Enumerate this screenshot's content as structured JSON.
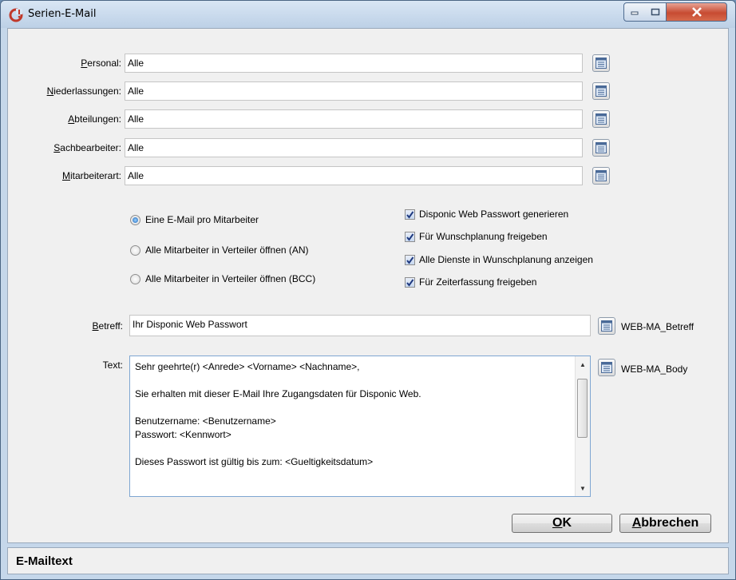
{
  "window": {
    "title": "Serien-E-Mail"
  },
  "filters": [
    {
      "label": "Personal:",
      "mnemonic": "P",
      "rest": "ersonal:",
      "value": "Alle"
    },
    {
      "label": "Niederlassungen:",
      "mnemonic": "N",
      "rest": "iederlassungen:",
      "value": "Alle"
    },
    {
      "label": "Abteilungen:",
      "mnemonic": "A",
      "rest": "bteilungen:",
      "value": "Alle"
    },
    {
      "label": "Sachbearbeiter:",
      "mnemonic": "S",
      "rest": "achbearbeiter:",
      "value": "Alle"
    },
    {
      "label": "Mitarbeiterart:",
      "mnemonic": "M",
      "rest": "itarbeiterart:",
      "value": "Alle"
    }
  ],
  "radios": [
    {
      "label": "Eine E-Mail pro Mitarbeiter",
      "selected": true
    },
    {
      "label": "Alle Mitarbeiter in Verteiler öffnen (AN)",
      "selected": false
    },
    {
      "label": "Alle Mitarbeiter in Verteiler öffnen (BCC)",
      "selected": false
    }
  ],
  "checkboxes": [
    {
      "label": "Disponic Web Passwort generieren",
      "checked": true
    },
    {
      "label": "Für Wunschplanung freigeben",
      "checked": true
    },
    {
      "label": "Alle Dienste in Wunschplanung anzeigen",
      "checked": true
    },
    {
      "label": "Für Zeiterfassung freigeben",
      "checked": true
    }
  ],
  "subject": {
    "label": "Betreff:",
    "mnemonic": "B",
    "rest": "etreff:",
    "value": "Ihr Disponic Web Passwort",
    "template": "WEB-MA_Betreff"
  },
  "body": {
    "label": "Text:",
    "template": "WEB-MA_Body",
    "lines": [
      "Sehr geehrte(r) <Anrede> <Vorname> <Nachname>,",
      "",
      "Sie erhalten mit dieser E-Mail Ihre Zugangsdaten für Disponic Web.",
      "",
      "Benutzername: <Benutzername>",
      "Passwort: <Kennwort>",
      "",
      "Dieses Passwort ist gültig bis zum: <Gueltigkeitsdatum>"
    ]
  },
  "buttons": {
    "ok": {
      "mnemonic": "O",
      "rest": "K"
    },
    "cancel": {
      "mnemonic": "A",
      "rest": "bbrechen"
    }
  },
  "status": {
    "text": "E-Mailtext"
  },
  "colors": {
    "accent": "#1a63b8",
    "close": "#c74b32",
    "frame": "#c5d7ea"
  }
}
